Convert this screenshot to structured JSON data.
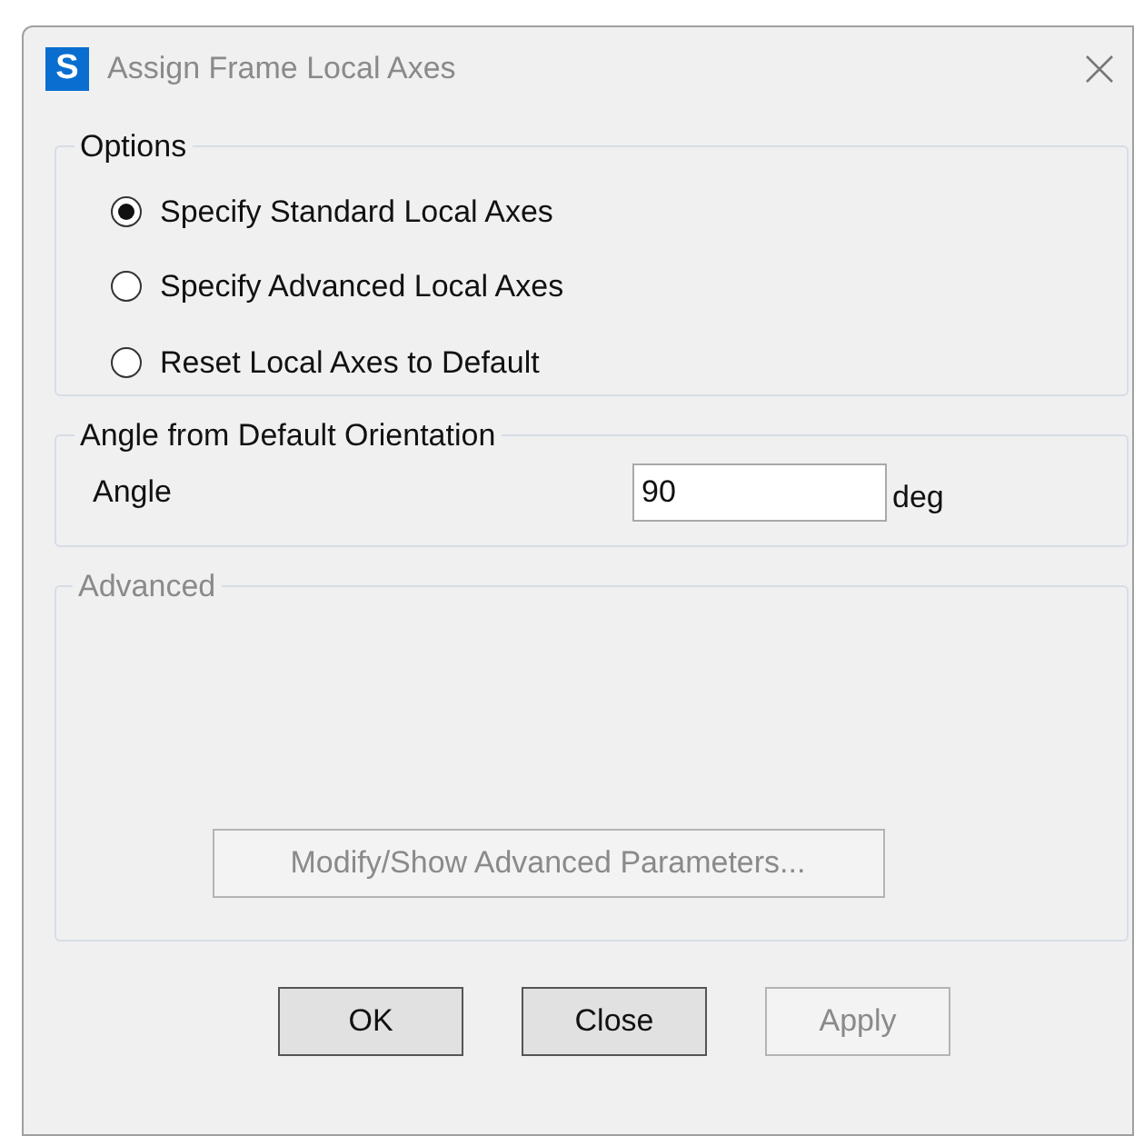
{
  "window": {
    "title": "Assign Frame Local Axes",
    "app_icon_letter": "S"
  },
  "options": {
    "title": "Options",
    "radios": [
      {
        "label": "Specify Standard Local Axes",
        "selected": true
      },
      {
        "label": "Specify Advanced Local Axes",
        "selected": false
      },
      {
        "label": "Reset Local Axes to Default",
        "selected": false
      }
    ]
  },
  "angle_group": {
    "title": "Angle from Default Orientation",
    "label": "Angle",
    "value": "90",
    "unit": "deg"
  },
  "advanced": {
    "title": "Advanced",
    "disabled": true,
    "button": {
      "label": "Modify/Show Advanced Parameters...",
      "disabled": true
    }
  },
  "buttons": [
    {
      "label": "OK",
      "disabled": false
    },
    {
      "label": "Close",
      "disabled": false
    },
    {
      "label": "Apply",
      "disabled": true
    }
  ]
}
